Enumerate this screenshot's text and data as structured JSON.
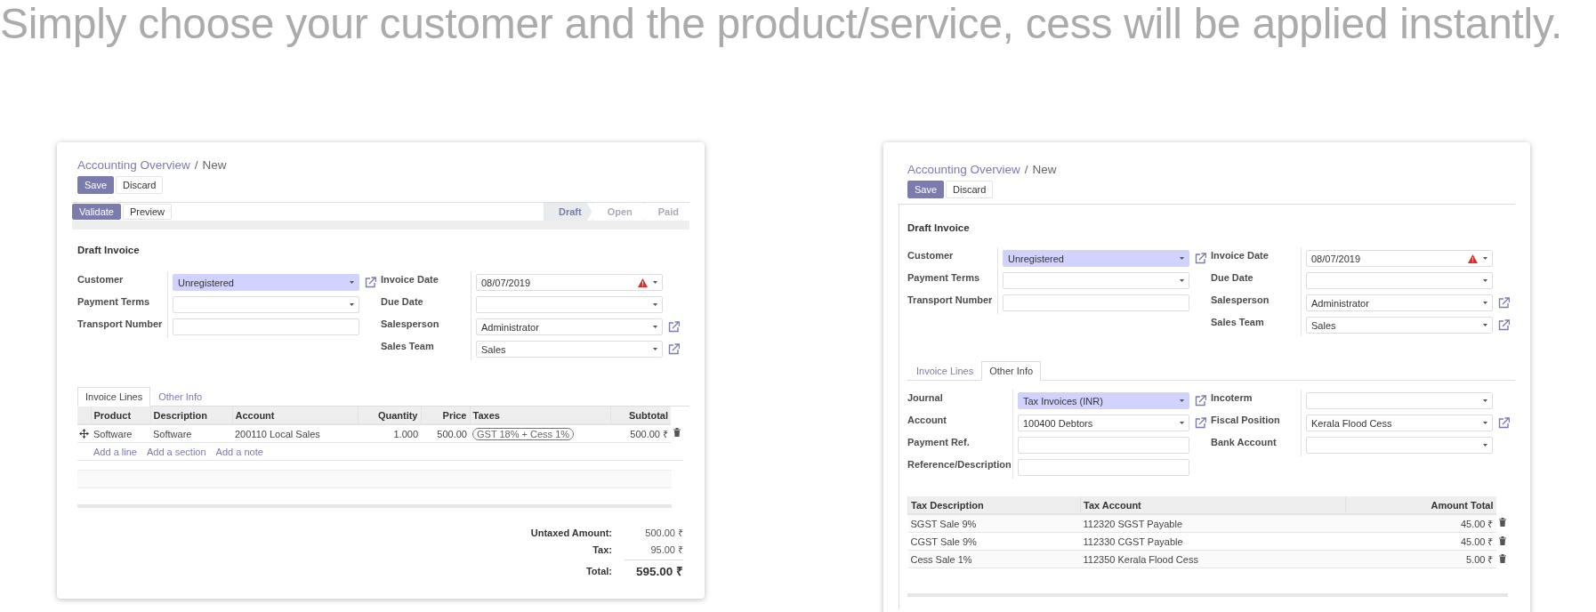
{
  "headline": "Simply choose your customer and the product/service, cess will be applied instantly.",
  "panels": [
    {
      "breadcrumb": {
        "parent": "Accounting Overview",
        "separator": "/",
        "current": "New"
      },
      "buttons": [
        {
          "label": "Save",
          "primary": true
        },
        {
          "label": "Discard",
          "primary": false
        }
      ],
      "statusbar": {
        "actions": [
          {
            "label": "Validate",
            "primary": true
          },
          {
            "label": "Preview",
            "primary": false
          }
        ],
        "stages": [
          {
            "label": "Draft",
            "selected": true
          },
          {
            "label": "Open",
            "selected": false
          },
          {
            "label": "Paid",
            "selected": false
          }
        ]
      },
      "title": "Draft Invoice",
      "field_groups": [
        [
          {
            "label": "Customer",
            "kind": "select",
            "value": "Unregistered",
            "required": true,
            "warning": false,
            "link": true
          },
          {
            "label": "Payment Terms",
            "kind": "select",
            "required": false,
            "warning": false,
            "link": false
          },
          {
            "label": "Transport Number",
            "kind": "text",
            "required": false,
            "warning": false,
            "link": false
          }
        ],
        [
          {
            "label": "Invoice Date",
            "kind": "select",
            "value": "08/07/2019",
            "required": false,
            "warning": true,
            "link": false
          },
          {
            "label": "Due Date",
            "kind": "select",
            "required": false,
            "warning": false,
            "link": false
          },
          {
            "label": "Salesperson",
            "kind": "select",
            "value": "Administrator",
            "required": false,
            "warning": false,
            "link": true
          },
          {
            "label": "Sales Team",
            "kind": "select",
            "value": "Sales",
            "required": false,
            "warning": false,
            "link": true
          }
        ]
      ],
      "tabs": [
        {
          "label": "Invoice Lines",
          "selected": true
        },
        {
          "label": "Other Info",
          "selected": false
        }
      ],
      "lines_table": {
        "columns": [
          {
            "label": "Product",
            "kind": "text"
          },
          {
            "label": "Description",
            "kind": "text"
          },
          {
            "label": "Account",
            "kind": "text"
          },
          {
            "label": "Quantity",
            "kind": "number"
          },
          {
            "label": "Price",
            "kind": "number"
          },
          {
            "label": "Taxes",
            "kind": "tags"
          },
          {
            "label": "Subtotal",
            "kind": "number"
          }
        ],
        "rows": [
          {
            "cells": [
              "Software",
              "Software",
              "200110 Local Sales",
              "1.000",
              "500.00",
              [
                "GST 18% + Cess 1%"
              ],
              "500.00 ₹"
            ]
          }
        ],
        "add_links": [
          "Add a line",
          "Add a section",
          "Add a note"
        ]
      },
      "totals": [
        {
          "label": "Untaxed Amount:",
          "value": "500.00 ₹",
          "kind": "line"
        },
        {
          "label": "Tax:",
          "value": "95.00 ₹",
          "kind": "line"
        },
        {
          "label": "Total:",
          "value": "595.00 ₹",
          "kind": "grand"
        }
      ]
    },
    {
      "breadcrumb": {
        "parent": "Accounting Overview",
        "separator": "/",
        "current": "New"
      },
      "buttons": [
        {
          "label": "Save",
          "primary": true
        },
        {
          "label": "Discard",
          "primary": false
        }
      ],
      "title": "Draft Invoice",
      "field_groups": [
        [
          {
            "label": "Customer",
            "kind": "select",
            "value": "Unregistered",
            "required": true,
            "warning": false,
            "link": true
          },
          {
            "label": "Payment Terms",
            "kind": "select",
            "required": false,
            "warning": false,
            "link": false
          },
          {
            "label": "Transport Number",
            "kind": "text",
            "required": false,
            "warning": false,
            "link": false
          }
        ],
        [
          {
            "label": "Invoice Date",
            "kind": "select",
            "value": "08/07/2019",
            "required": false,
            "warning": true,
            "link": false
          },
          {
            "label": "Due Date",
            "kind": "select",
            "required": false,
            "warning": false,
            "link": false
          },
          {
            "label": "Salesperson",
            "kind": "select",
            "value": "Administrator",
            "required": false,
            "warning": false,
            "link": true
          },
          {
            "label": "Sales Team",
            "kind": "select",
            "value": "Sales",
            "required": false,
            "warning": false,
            "link": true
          }
        ]
      ],
      "tabs": [
        {
          "label": "Invoice Lines",
          "selected": false
        },
        {
          "label": "Other Info",
          "selected": true
        }
      ],
      "tab_fields": [
        [
          {
            "label": "Journal",
            "kind": "select",
            "value": "Tax Invoices (INR)",
            "required": true,
            "warning": false,
            "link": true
          },
          {
            "label": "Account",
            "kind": "select",
            "value": "100400 Debtors",
            "required": false,
            "warning": false,
            "link": true
          },
          {
            "label": "Payment Ref.",
            "kind": "text",
            "required": false,
            "warning": false,
            "link": false
          },
          {
            "label": "Reference/Description",
            "kind": "text",
            "required": false,
            "warning": false,
            "link": false
          }
        ],
        [
          {
            "label": "Incoterm",
            "kind": "select",
            "required": false,
            "warning": false,
            "link": false
          },
          {
            "label": "Fiscal Position",
            "kind": "select",
            "value": "Kerala Flood Cess",
            "required": false,
            "warning": false,
            "link": true
          },
          {
            "label": "Bank Account",
            "kind": "select",
            "required": false,
            "warning": false,
            "link": false
          }
        ]
      ],
      "tax_table": {
        "columns": [
          {
            "label": "Tax Description",
            "kind": "text"
          },
          {
            "label": "Tax Account",
            "kind": "text"
          },
          {
            "label": "Amount Total",
            "kind": "number"
          }
        ],
        "rows": [
          {
            "cells": [
              "SGST Sale 9%",
              "112320 SGST Payable",
              "45.00 ₹"
            ]
          },
          {
            "cells": [
              "CGST Sale 9%",
              "112330 CGST Payable",
              "45.00 ₹"
            ]
          },
          {
            "cells": [
              "Cess Sale 1%",
              "112350 Kerala Flood Cess",
              "5.00 ₹"
            ]
          }
        ]
      }
    }
  ]
}
